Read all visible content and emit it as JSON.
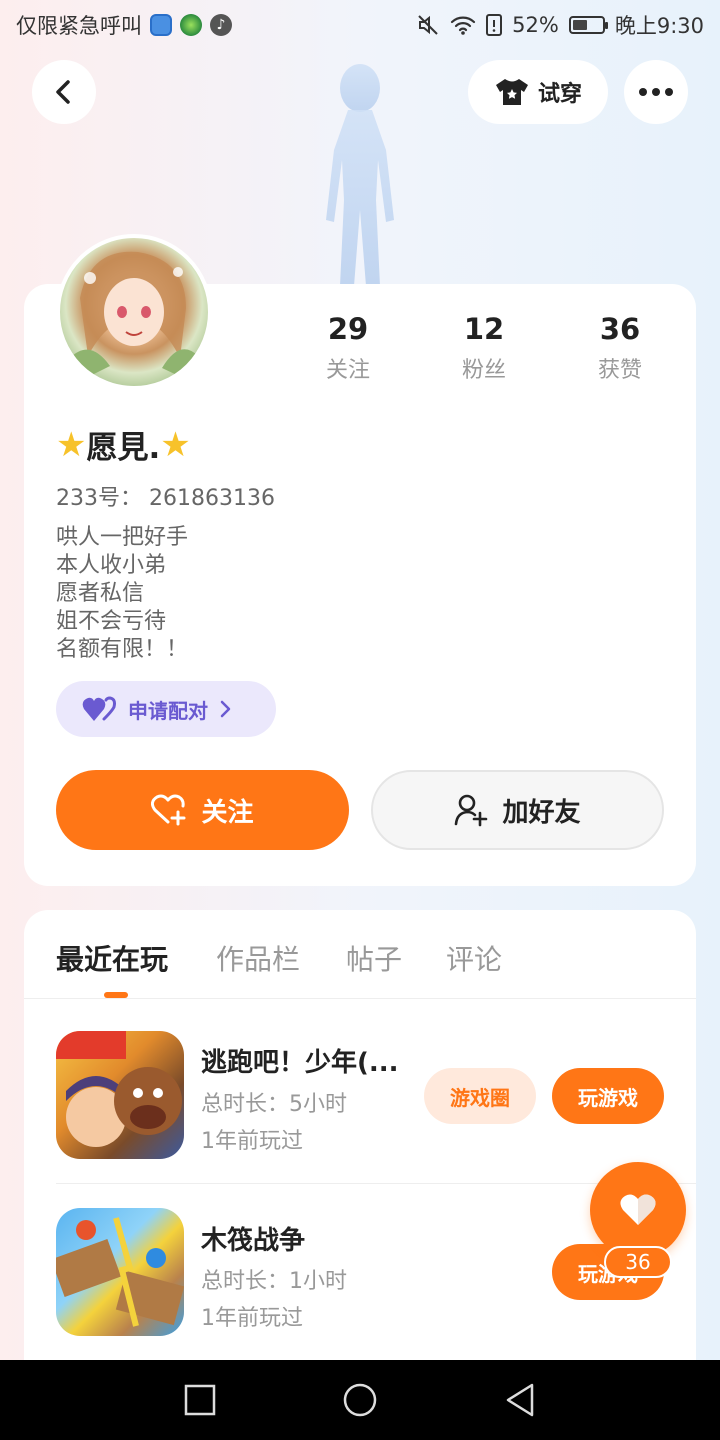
{
  "status_bar": {
    "left_text": "仅限紧急呼叫",
    "battery": "52%",
    "battery_level": 0.52,
    "time": "晚上9:30"
  },
  "header": {
    "try_on_label": "试穿"
  },
  "profile": {
    "stats": [
      {
        "value": "29",
        "label": "关注"
      },
      {
        "value": "12",
        "label": "粉丝"
      },
      {
        "value": "36",
        "label": "获赞"
      }
    ],
    "username": "愿見.",
    "user_id": "233号： 261863136",
    "bio": [
      "哄人一把好手",
      "本人收小弟",
      "愿者私信",
      "姐不会亏待",
      "名额有限！！"
    ],
    "match_label": "申请配对",
    "follow_label": "关注",
    "add_friend_label": "加好友"
  },
  "tabs": [
    "最近在玩",
    "作品栏",
    "帖子",
    "评论"
  ],
  "games": [
    {
      "title": "逃跑吧！少年(...",
      "duration": "总时长：5小时",
      "last_played": "1年前玩过",
      "circle_label": "游戏圈",
      "play_label": "玩游戏"
    },
    {
      "title": "木筏战争",
      "duration": "总时长：1小时",
      "last_played": "1年前玩过",
      "play_label": "玩游戏"
    }
  ],
  "floating_like": {
    "count": "36"
  },
  "colors": {
    "accent": "#ff7616",
    "match": "#6a5ad1",
    "match_bg": "#ebe8fc"
  }
}
